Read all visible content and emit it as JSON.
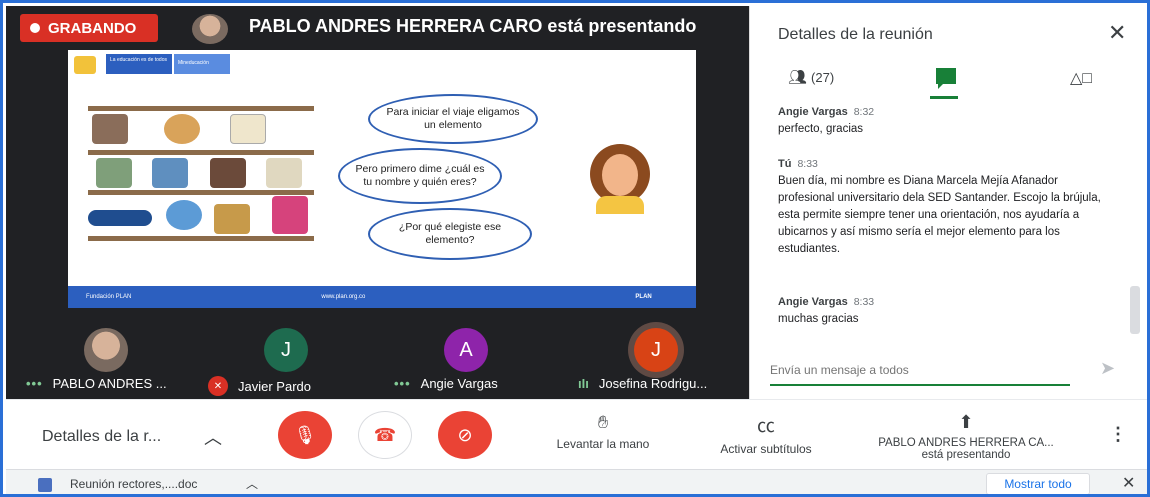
{
  "recording": {
    "label": "GRABANDO"
  },
  "presenter": {
    "title": "PABLO ANDRES HERRERA CARO está presentando"
  },
  "slide": {
    "brand1": "La educación es de todos",
    "brand2": "Mineducación",
    "bubble1": "Para iniciar el viaje eligamos un elemento",
    "bubble2": "Pero primero dime ¿cuál es tu nombre y quién eres?",
    "bubble3": "¿Por qué elegiste ese elemento?",
    "footer_left": "Fundación PLAN",
    "footer_mid": "www.plan.org.co",
    "footer_right": "PLAN"
  },
  "participants": [
    {
      "name": "PABLO ANDRES ...",
      "initial": "",
      "color": "#8a7a70",
      "state": "speaking"
    },
    {
      "name": "Javier Pardo",
      "initial": "J",
      "color": "#1e6b4f",
      "state": "muted"
    },
    {
      "name": "Angie Vargas",
      "initial": "A",
      "color": "#8e24aa",
      "state": "speaking"
    },
    {
      "name": "Josefina Rodrigu...",
      "initial": "J",
      "color": "#d84315",
      "state": "talking"
    }
  ],
  "panel": {
    "title": "Detalles de la reunión",
    "people_count": "(27)",
    "messages": [
      {
        "author": "Angie Vargas",
        "time": "8:32",
        "text": "perfecto, gracias"
      },
      {
        "author": "Tú",
        "time": "8:33",
        "text": "Buen día, mi nombre es Diana Marcela Mejía Afanador profesional universitario dela SED Santander. Escojo la brújula, esta permite siempre tener una orientación, nos ayudaría a ubicarnos y así mismo sería el mejor elemento para los estudiantes."
      },
      {
        "author": "Angie Vargas",
        "time": "8:33",
        "text": "muchas gracias"
      }
    ],
    "input_placeholder": "Envía un mensaje a todos"
  },
  "controls": {
    "details_label": "Detalles de la r...",
    "raise_hand": "Levantar la mano",
    "captions": "Activar subtítulos",
    "presenting_line1": "PABLO ANDRES HERRERA CA...",
    "presenting_line2": "está presentando"
  },
  "downloads": {
    "file_name": "Reunión rectores,....doc",
    "show_all": "Mostrar todo"
  },
  "colors": {
    "record": "#d93025",
    "accent": "#188038",
    "frame": "#2a6fd6"
  }
}
